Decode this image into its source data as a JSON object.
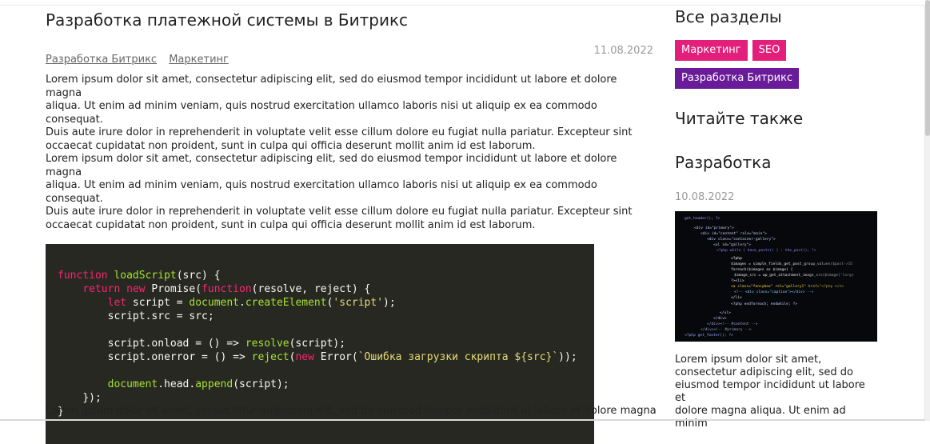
{
  "article": {
    "title": "Разработка платежной системы в Битрикс",
    "date": "11.08.2022",
    "tags": [
      "Разработка Битрикс",
      "Маркетинг"
    ],
    "paragraph1": [
      "Lorem ipsum dolor sit amet, consectetur adipiscing elit, sed do eiusmod tempor incididunt ut labore et dolore magna",
      "aliqua. Ut enim ad minim veniam, quis nostrud exercitation ullamco laboris nisi ut aliquip ex ea commodo consequat.",
      "Duis aute irure dolor in reprehenderit in voluptate velit esse cillum dolore eu fugiat nulla pariatur. Excepteur sint",
      "occaecat cupidatat non proident, sunt in culpa qui officia deserunt mollit anim id est laborum.",
      "Lorem ipsum dolor sit amet, consectetur adipiscing elit, sed do eiusmod tempor incididunt ut labore et dolore magna",
      "aliqua. Ut enim ad minim veniam, quis nostrud exercitation ullamco laboris nisi ut aliquip ex ea commodo consequat.",
      "Duis aute irure dolor in reprehenderit in voluptate velit esse cillum dolore eu fugiat nulla pariatur. Excepteur sint",
      "occaecat cupidatat non proident, sunt in culpa qui officia deserunt mollit anim id est laborum."
    ],
    "code": {
      "l1_kw": "function",
      "l1_fn": "loadScript",
      "l1_rest": "(src) {",
      "l2_kw": "return new",
      "l2_cls": "Promise",
      "l2_p": "(",
      "l2_kw2": "function",
      "l2_rest": "(resolve, reject) {",
      "l3_kw": "let",
      "l3_a": " script = ",
      "l3_doc": "document",
      "l3_dot": ".",
      "l3_fn": "createElement",
      "l3_p": "(",
      "l3_str": "'script'",
      "l3_end": ");",
      "l4": "script.src = src;",
      "l5_a": "script.onload = () => ",
      "l5_fn": "resolve",
      "l5_end": "(script);",
      "l6_a": "script.onerror = () => ",
      "l6_fn": "reject",
      "l6_p": "(",
      "l6_kw": "new",
      "l6_cls": " Error",
      "l6_p2": "(",
      "l6_str": "`Ошибка загрузки скрипта ${src}`",
      "l6_end": "));",
      "l7_doc": "document",
      "l7_a": ".head.",
      "l7_fn": "append",
      "l7_end": "(script);",
      "l8": "});",
      "l9": "}"
    },
    "bottom_text": "Lorem ipsum dolor sit amet, consectetur adipiscing elit, sed do eiusmod tempor incididunt ut labore et dolore magna"
  },
  "sidebar": {
    "sections_title": "Все разделы",
    "badges": [
      "Маркетинг",
      "SEO",
      "Разработка Битрикс"
    ],
    "read_also": "Читайте также",
    "category": "Разработка",
    "post_date": "10.08.2022",
    "post_text": [
      "Lorem ipsum dolor sit amet,",
      "consectetur adipiscing elit, sed do",
      "eiusmod tempor incididunt ut labore et",
      "dolore magna aliqua. Ut enim ad minim"
    ]
  },
  "colors": {
    "badge_pink": "#e41f7b",
    "badge_purple": "#6a1b9a",
    "code_bg": "#272822",
    "keyword": "#f92672",
    "function": "#a6e22e",
    "string": "#e6db74"
  }
}
